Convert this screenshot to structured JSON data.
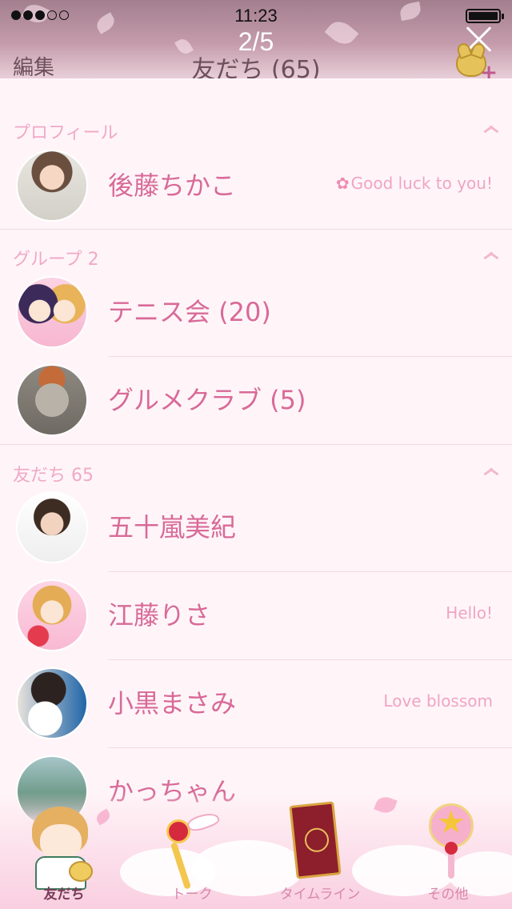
{
  "status_bar": {
    "time": "11:23"
  },
  "header": {
    "page_counter": "2/5",
    "edit_label": "編集",
    "title": "友だち (65)"
  },
  "sections": [
    {
      "title": "プロフィール"
    },
    {
      "title": "グループ 2"
    },
    {
      "title": "友だち 65"
    }
  ],
  "profile": {
    "name": "後藤ちかこ",
    "status": "Good luck to you!"
  },
  "groups": [
    {
      "name": "テニス会 (20)"
    },
    {
      "name": "グルメクラブ (5)"
    }
  ],
  "friends": [
    {
      "name": "五十嵐美紀",
      "status": ""
    },
    {
      "name": "江藤りさ",
      "status": "Hello!"
    },
    {
      "name": "小黒まさみ",
      "status": "Love blossom"
    },
    {
      "name": "かっちゃん",
      "status": ""
    }
  ],
  "tabs": [
    {
      "label": "友だち",
      "icon": "sakura-character-icon",
      "active": true
    },
    {
      "label": "トーク",
      "icon": "winged-key-wand-icon",
      "active": false
    },
    {
      "label": "タイムライン",
      "icon": "clow-card-icon",
      "active": false
    },
    {
      "label": "その他",
      "icon": "star-wand-icon",
      "active": false
    }
  ],
  "colors": {
    "accent": "#d86a98",
    "section_title": "#f0a9c6",
    "background": "#fff5f8"
  }
}
